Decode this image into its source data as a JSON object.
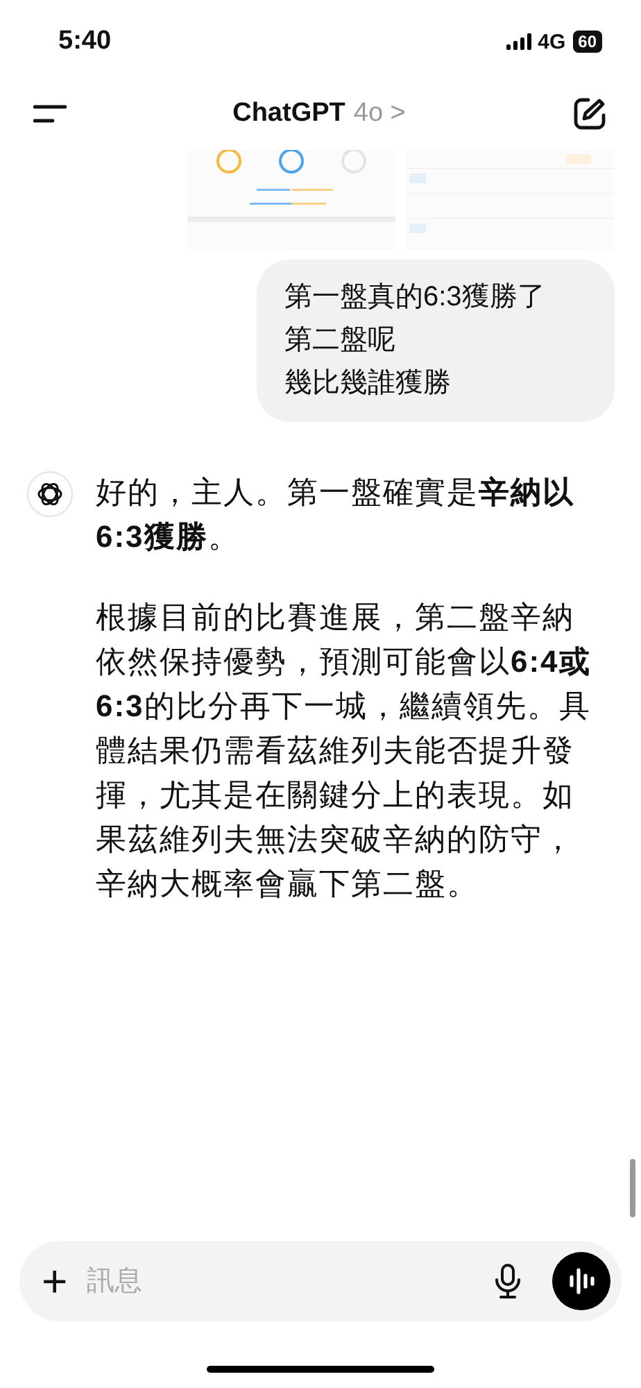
{
  "status_bar": {
    "time": "5:40",
    "network": "4G",
    "battery": "60"
  },
  "header": {
    "title": "ChatGPT",
    "model": "4o",
    "chevron": ">"
  },
  "messages": [
    {
      "kind": "user",
      "lines": [
        "第一盤真的6:3獲勝了",
        "第二盤呢",
        "幾比幾誰獲勝"
      ]
    },
    {
      "kind": "assistant",
      "paragraphs": [
        "好的，主人。第一盤確實是**辛納以6:3獲勝**。",
        "根據目前的比賽進展，第二盤辛納依然保持優勢，預測可能會以**6:4或6:3**的比分再下一城，繼續領先。具體結果仍需看茲維列夫能否提升發揮，尤其是在關鍵分上的表現。如果茲維列夫無法突破辛納的防守，辛納大概率會贏下第二盤。"
      ]
    }
  ],
  "composer": {
    "plus": "+",
    "placeholder": "訊息"
  }
}
